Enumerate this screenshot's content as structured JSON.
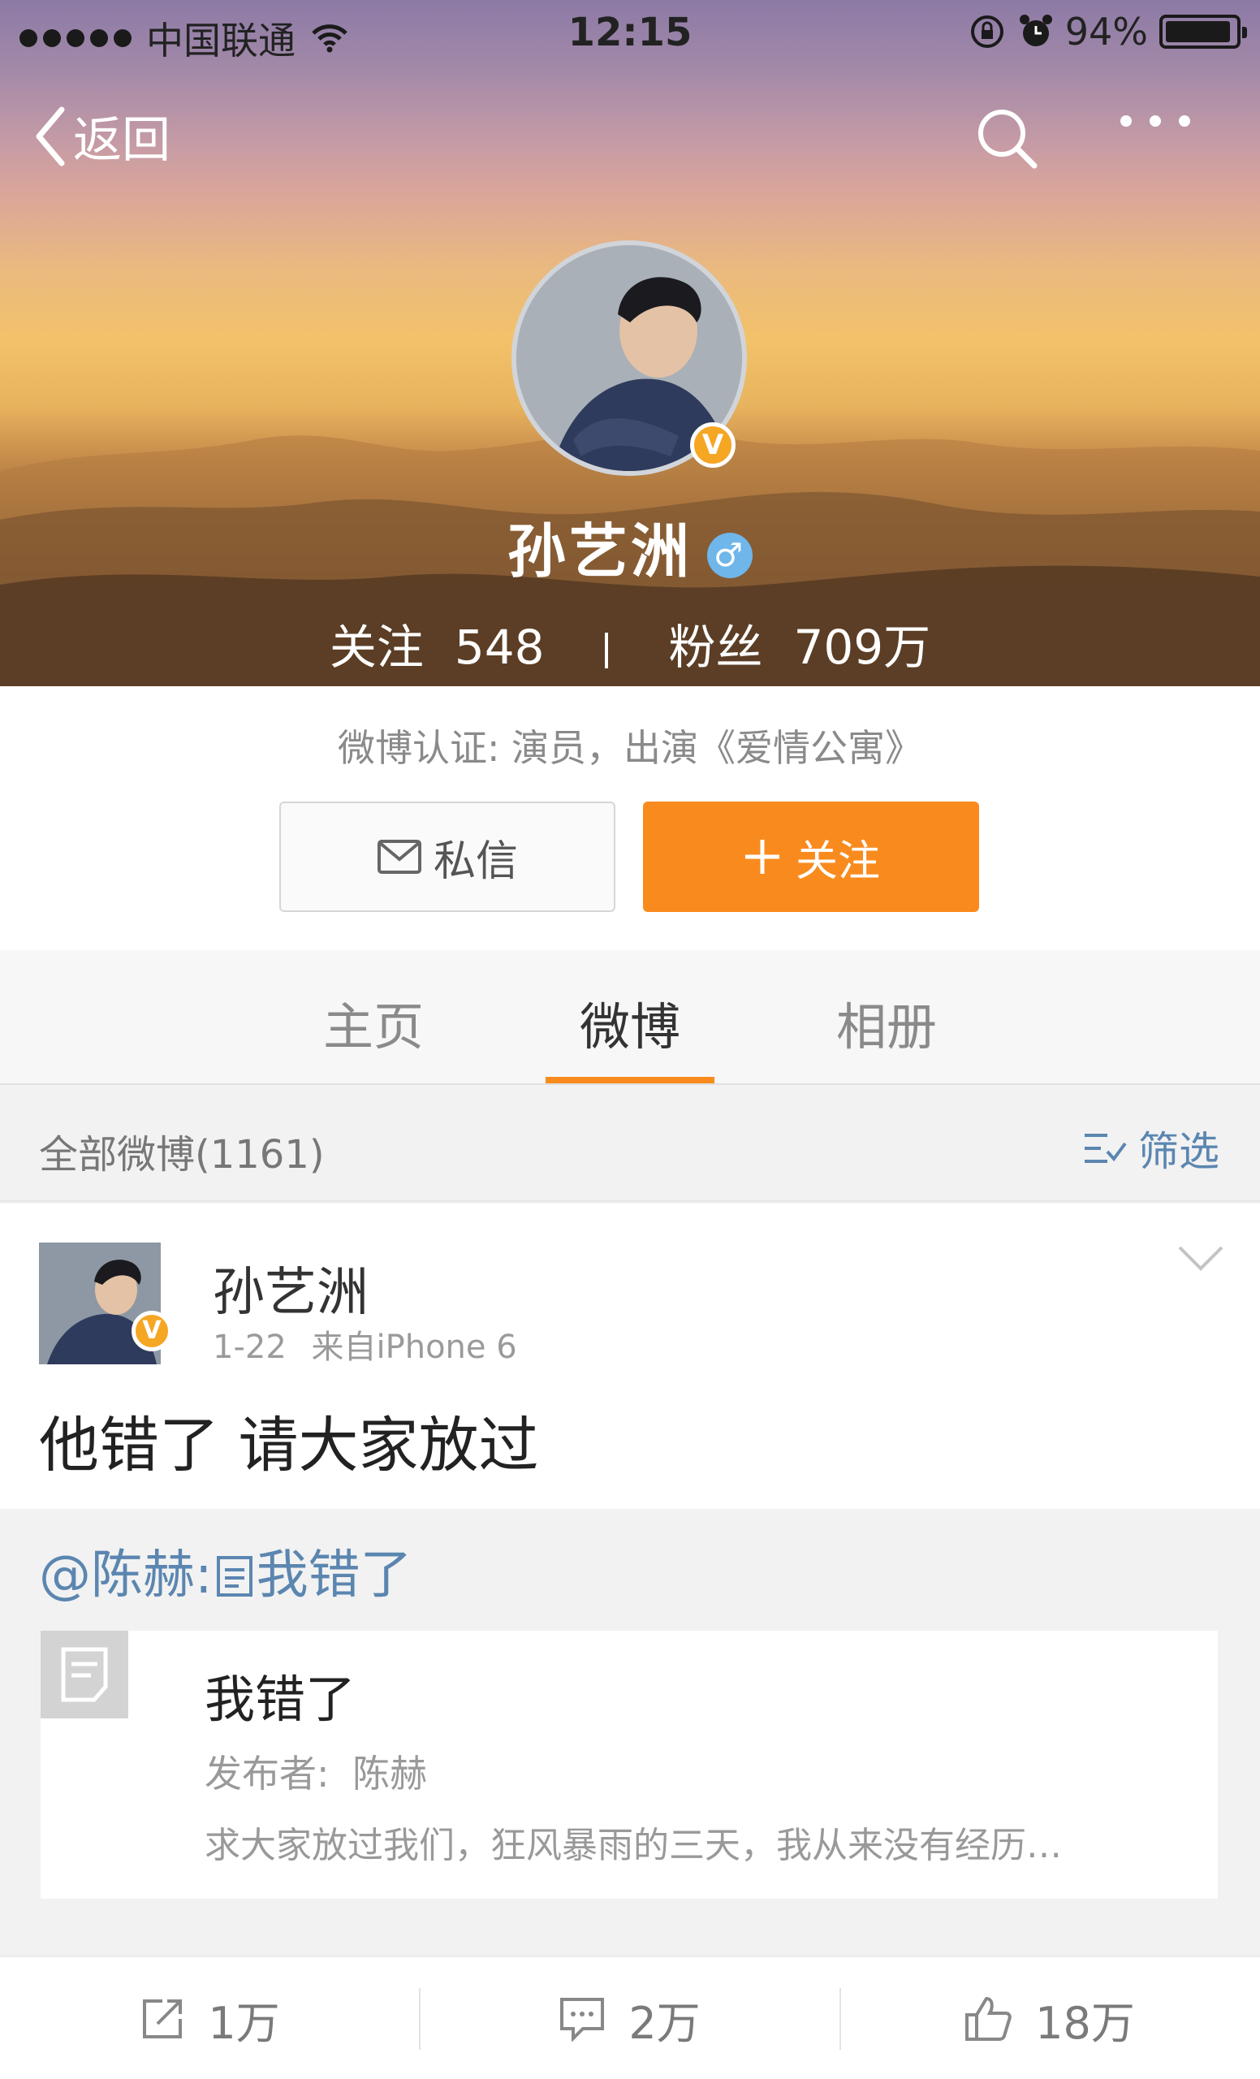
{
  "status_bar": {
    "carrier": "中国联通",
    "time": "12:15",
    "battery_percent": "94%",
    "battery_level": 0.94
  },
  "nav": {
    "back_label": "返回"
  },
  "profile": {
    "name": "孙艺洲",
    "gender_symbol": "♂",
    "verified_badge": "V",
    "following_label": "关注",
    "following_count": "548",
    "followers_label": "粉丝",
    "followers_count": "709万",
    "verification": "微博认证: 演员，出演《爱情公寓》"
  },
  "actions": {
    "message_label": "私信",
    "follow_label": "关注",
    "follow_plus": "+"
  },
  "tabs": [
    {
      "label": "主页",
      "active": false
    },
    {
      "label": "微博",
      "active": true
    },
    {
      "label": "相册",
      "active": false
    }
  ],
  "filter_bar": {
    "all_posts": "全部微博(1161)",
    "filter_label": "筛选"
  },
  "post": {
    "author": "孙艺洲",
    "badge": "V",
    "date": "1-22",
    "source": "来自iPhone 6",
    "text": "他错了 请大家放过",
    "repost": {
      "mention": "@陈赫",
      "colon": ":",
      "text": "我错了",
      "article": {
        "title": "我错了",
        "author_label": "发布者:",
        "author": "陈赫",
        "summary": "求大家放过我们，狂风暴雨的三天，我从来没有经历…"
      }
    },
    "stats": {
      "reposts": "1万",
      "comments": "2万",
      "likes": "18万"
    }
  },
  "colors": {
    "accent": "#f98b1e",
    "link": "#5b86b0",
    "badge": "#f5a623",
    "gender": "#6fb6ea"
  },
  "icons": [
    "signal-dots-icon",
    "wifi-icon",
    "orientation-lock-icon",
    "alarm-icon",
    "battery-icon",
    "back-chevron-icon",
    "search-icon",
    "more-icon",
    "mail-icon",
    "plus-icon",
    "filter-icon",
    "chevron-down-icon",
    "article-icon",
    "repost-icon",
    "comment-icon",
    "like-icon"
  ]
}
